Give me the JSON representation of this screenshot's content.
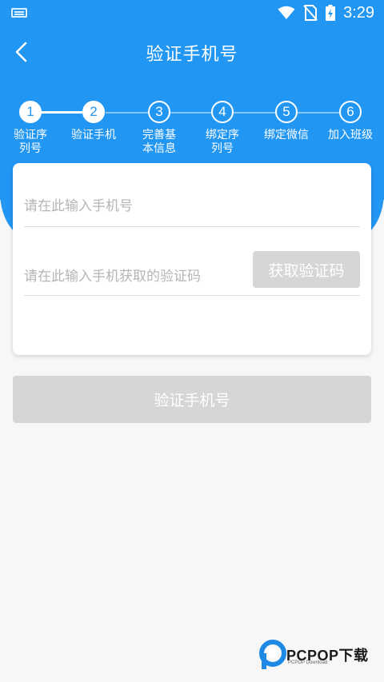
{
  "status_bar": {
    "time": "3:29"
  },
  "topbar": {
    "title": "验证手机号"
  },
  "stepper": {
    "steps": [
      {
        "num": "1",
        "label": "验证序\n列号",
        "state": "done"
      },
      {
        "num": "2",
        "label": "验证手机",
        "state": "current"
      },
      {
        "num": "3",
        "label": "完善基\n本信息",
        "state": "pending"
      },
      {
        "num": "4",
        "label": "绑定序\n列号",
        "state": "pending"
      },
      {
        "num": "5",
        "label": "绑定微信",
        "state": "pending"
      },
      {
        "num": "6",
        "label": "加入班级",
        "state": "pending"
      }
    ]
  },
  "form": {
    "phone_placeholder": "请在此输入手机号",
    "phone_value": "",
    "code_placeholder": "请在此输入手机获取的验证码",
    "code_value": "",
    "get_code_label": "获取验证码"
  },
  "verify_button_label": "验证手机号",
  "watermark": {
    "brand": "PCPOP下载",
    "sub": "PCPOP Download"
  },
  "colors": {
    "primary": "#2196f3",
    "disabled_button": "#d6d6d6",
    "background": "#f7f7f7"
  }
}
